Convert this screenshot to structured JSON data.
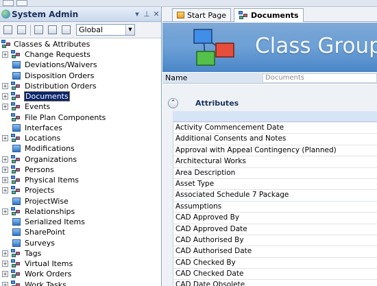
{
  "app": {
    "panel_title": "System Admin",
    "panel_controls": [
      "▾",
      "⊥",
      "✕"
    ],
    "scope_select": "Global"
  },
  "tree": {
    "root": "Classes & Attributes",
    "items": [
      {
        "label": "Change Requests",
        "expandable": true,
        "icon": "class-group-icon"
      },
      {
        "label": "Deviations/Waivers",
        "expandable": false,
        "icon": "class-icon"
      },
      {
        "label": "Disposition Orders",
        "expandable": false,
        "icon": "class-icon"
      },
      {
        "label": "Distribution Orders",
        "expandable": true,
        "icon": "class-group-icon"
      },
      {
        "label": "Documents",
        "expandable": true,
        "icon": "class-group-icon",
        "selected": true
      },
      {
        "label": "Events",
        "expandable": true,
        "icon": "class-group-icon"
      },
      {
        "label": "File Plan Components",
        "expandable": false,
        "icon": "class-group-icon"
      },
      {
        "label": "Interfaces",
        "expandable": false,
        "icon": "class-icon"
      },
      {
        "label": "Locations",
        "expandable": true,
        "icon": "class-group-icon"
      },
      {
        "label": "Modifications",
        "expandable": false,
        "icon": "class-icon"
      },
      {
        "label": "Organizations",
        "expandable": true,
        "icon": "class-group-icon"
      },
      {
        "label": "Persons",
        "expandable": true,
        "icon": "class-group-icon"
      },
      {
        "label": "Physical Items",
        "expandable": true,
        "icon": "class-group-icon"
      },
      {
        "label": "Projects",
        "expandable": true,
        "icon": "class-group-icon"
      },
      {
        "label": "ProjectWise",
        "expandable": false,
        "icon": "class-icon"
      },
      {
        "label": "Relationships",
        "expandable": true,
        "icon": "class-group-icon"
      },
      {
        "label": "Serialized Items",
        "expandable": false,
        "icon": "class-icon"
      },
      {
        "label": "SharePoint",
        "expandable": false,
        "icon": "class-icon"
      },
      {
        "label": "Surveys",
        "expandable": false,
        "icon": "class-icon"
      },
      {
        "label": "Tags",
        "expandable": true,
        "icon": "class-group-icon"
      },
      {
        "label": "Virtual Items",
        "expandable": true,
        "icon": "class-group-icon"
      },
      {
        "label": "Work Orders",
        "expandable": true,
        "icon": "class-group-icon"
      },
      {
        "label": "Work Tasks",
        "expandable": true,
        "icon": "class-group-icon"
      }
    ]
  },
  "tabs": [
    {
      "label": "Start Page",
      "active": false
    },
    {
      "label": "Documents",
      "active": true
    }
  ],
  "banner": {
    "title": "Class Group"
  },
  "name_field": {
    "label": "Name",
    "value": "Documents"
  },
  "attributes": {
    "heading": "Attributes",
    "rows": [
      "Activity Commencement Date",
      "Additional Consents and Notes",
      "Approval with Appeal Contingency (Planned)",
      "Architectural Works",
      "Area Description",
      "Asset Type",
      "Associated Schedule 7 Package",
      "Assumptions",
      "CAD Approved By",
      "CAD Approved Date",
      "CAD Authorised By",
      "CAD Authorised Date",
      "CAD Checked By",
      "CAD Checked Date",
      "CAD Date Obsolete"
    ]
  }
}
